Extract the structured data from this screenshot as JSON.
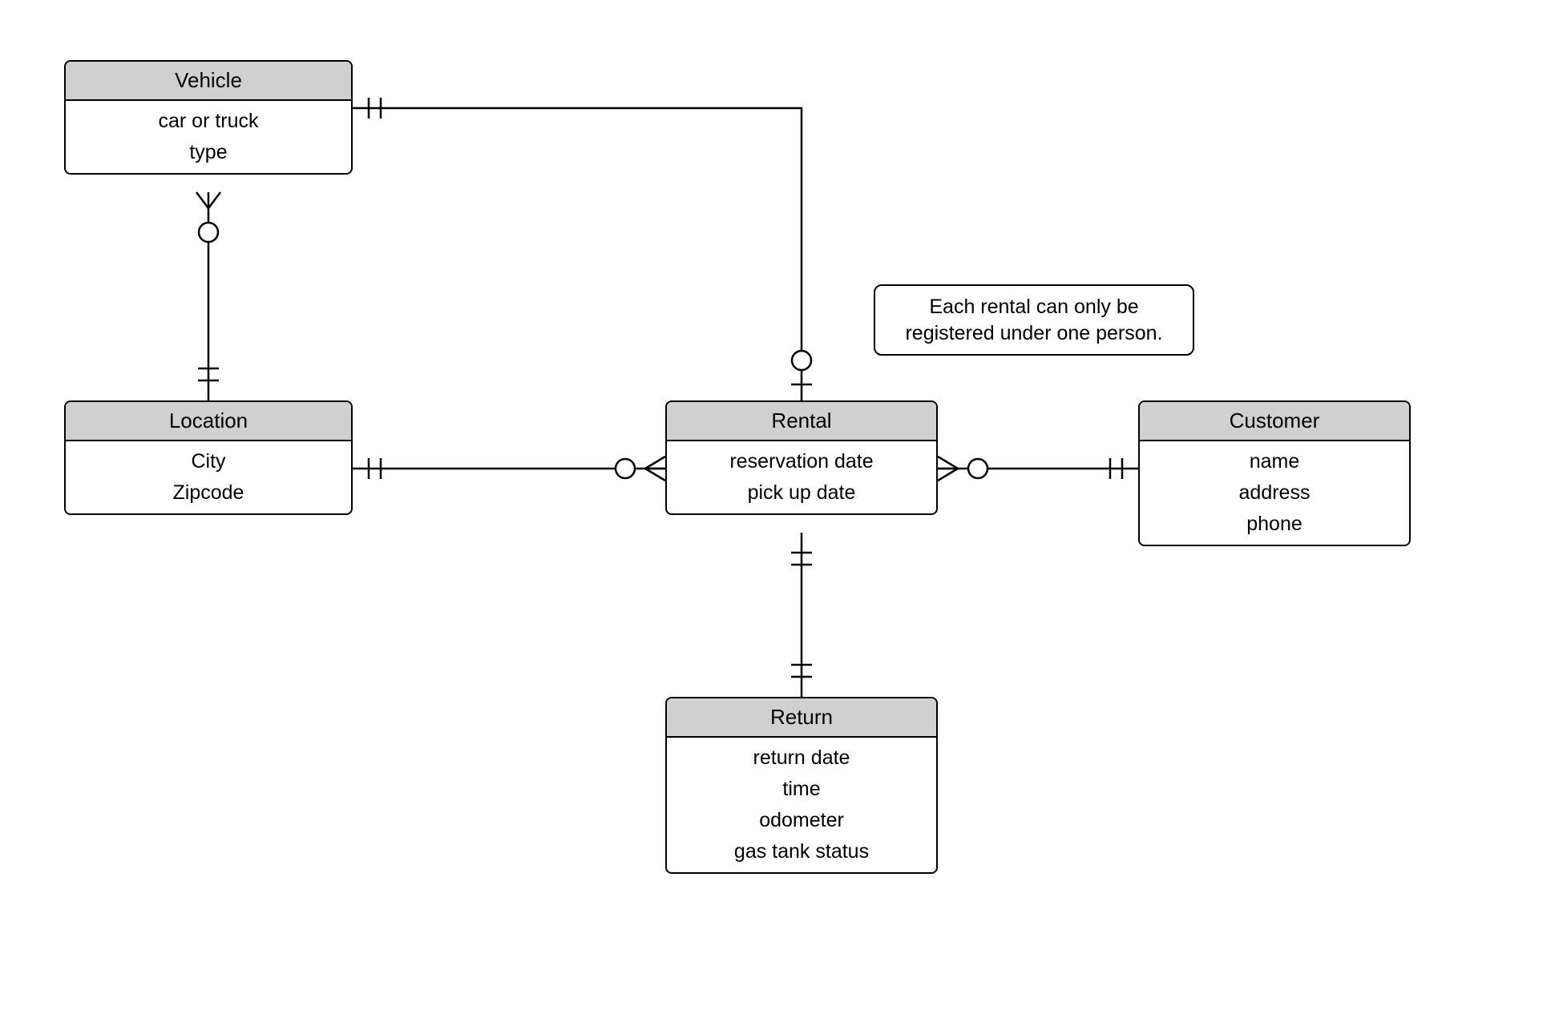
{
  "entities": {
    "vehicle": {
      "name": "Vehicle",
      "attrs": [
        "car or truck",
        "type"
      ]
    },
    "location": {
      "name": "Location",
      "attrs": [
        "City",
        "Zipcode"
      ]
    },
    "rental": {
      "name": "Rental",
      "attrs": [
        "reservation date",
        "pick up date"
      ]
    },
    "customer": {
      "name": "Customer",
      "attrs": [
        "name",
        "address",
        "phone"
      ]
    },
    "return": {
      "name": "Return",
      "attrs": [
        "return date",
        "time",
        "odometer",
        "gas tank status"
      ]
    }
  },
  "note": {
    "line1": "Each rental can only be",
    "line2": "registered under one person."
  },
  "relationships": [
    {
      "from": "Vehicle",
      "to": "Location",
      "from_card": "zero-or-many",
      "to_card": "one-and-only-one"
    },
    {
      "from": "Vehicle",
      "to": "Rental",
      "from_card": "one-and-only-one",
      "to_card": "zero-or-one"
    },
    {
      "from": "Location",
      "to": "Rental",
      "from_card": "one-and-only-one",
      "to_card": "zero-or-many"
    },
    {
      "from": "Rental",
      "to": "Customer",
      "from_card": "zero-or-many",
      "to_card": "one-and-only-one"
    },
    {
      "from": "Rental",
      "to": "Return",
      "from_card": "one-and-only-one",
      "to_card": "one-and-only-one"
    }
  ]
}
